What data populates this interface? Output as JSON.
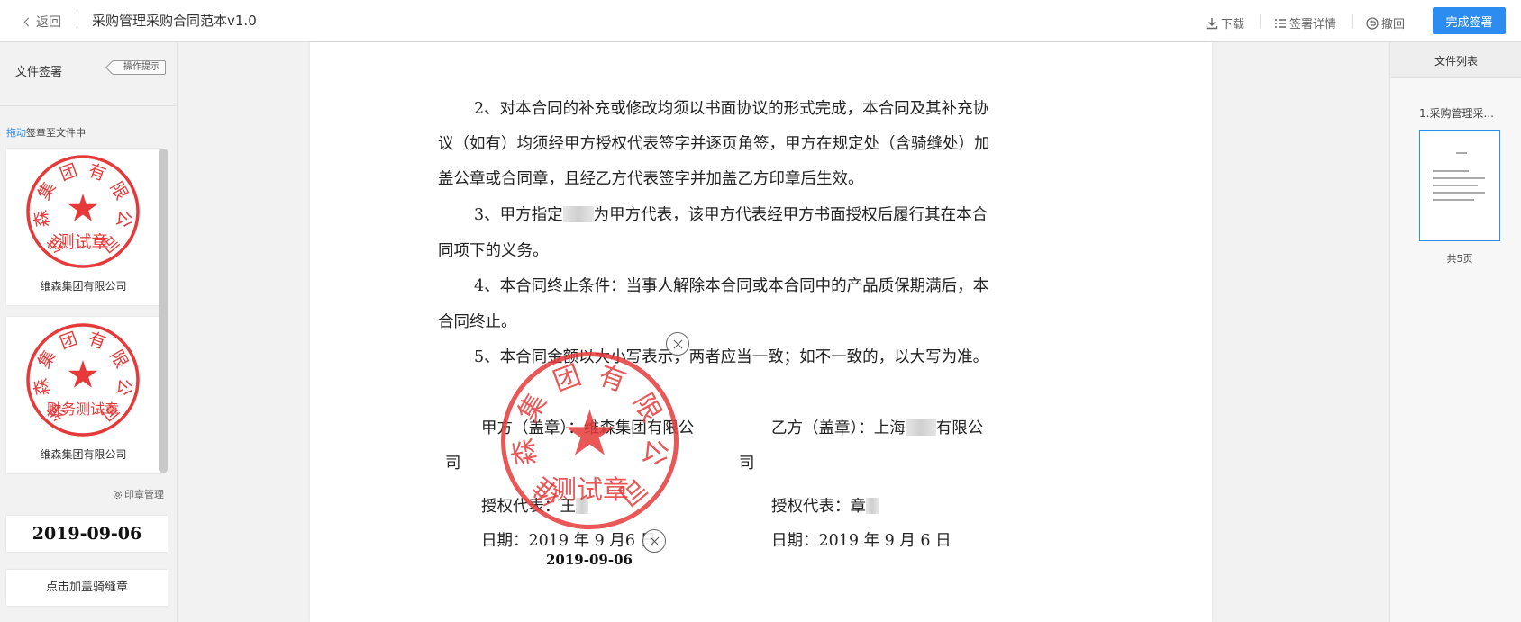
{
  "topbar": {
    "back_label": "返回",
    "title": "采购管理采购合同范本v1.0",
    "download_label": "下载",
    "sign_detail_label": "签署详情",
    "withdraw_label": "撤回",
    "finish_label": "完成签署"
  },
  "left_panel": {
    "title": "文件签署",
    "op_hint": "操作提示",
    "drag_link": "拖动",
    "drag_rest": "签章至文件中",
    "seals": [
      {
        "company": "维森集团有限公司",
        "arc_text": "维森集团有限公司",
        "center_text": "测试章"
      },
      {
        "company": "维森集团有限公司",
        "arc_text": "维森集团有限公司",
        "center_text": "财务测试章"
      }
    ],
    "seal_mgmt": "印章管理",
    "date_stamp": "2019-09-06",
    "riding_seal": "点击加盖骑缝章"
  },
  "document": {
    "lines": [
      "2、对本合同的补充或修改均须以书面协议的形式完成，本合同及其补充协",
      "议（如有）均须经甲方授权代表签字并逐页角签，甲方在规定处（含骑缝处）加",
      "盖公章或合同章，且经乙方代表签字并加盖乙方印章后生效。",
      "3、甲方指定",
      "为甲方代表，该甲方代表经甲方书面授权后履行其在本合",
      "同项下的义务。",
      "4、本合同终止条件：当事人解除本合同或本合同中的产品质保期满后，本",
      "合同终止。",
      "5、本合同金额以大小写表示，两者应当一致；如不一致的，以大写为准。"
    ],
    "party_a": "甲方（盖章）：维森集团有限公",
    "party_a_wrap": "司",
    "party_b_prefix": "乙方（盖章）：上海",
    "party_b_suffix": "有限公",
    "party_b_wrap": "司",
    "rep_a": "授权代表：王",
    "rep_b": "授权代表：章",
    "date_a_prefix": "日期：2019 年 9 月",
    "date_a_suffix": "6 日",
    "date_b": "日期：2019 年 9 月 6 日",
    "placed_stamp_arc": "维森集团有限公司",
    "placed_stamp_center": "测试章",
    "placed_date": "2019-09-06"
  },
  "right_panel": {
    "title": "文件列表",
    "file_name": "1.采购管理采...",
    "page_count": "共5页"
  },
  "colors": {
    "accent": "#2d8cf0",
    "stamp_red": "#e63a3a"
  }
}
